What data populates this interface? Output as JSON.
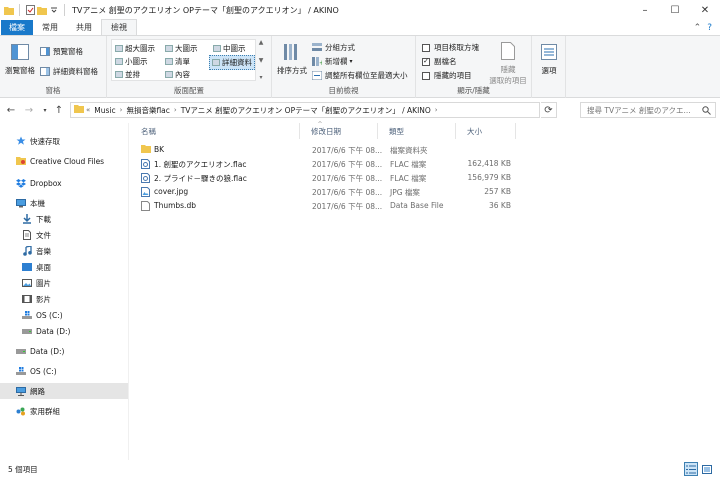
{
  "window": {
    "title": "TVアニメ 創聖のアクエリオン OPテーマ「創聖のアクエリオン」 / AKINO",
    "minimize": "–",
    "maximize": "☐",
    "close": "✕"
  },
  "tabs": {
    "file": "檔案",
    "home": "常用",
    "share": "共用",
    "view": "檢視"
  },
  "ribbon": {
    "panes": {
      "label": "窗格",
      "nav_pane": "瀏覽窗格",
      "preview_pane": "預覽窗格",
      "details_pane": "詳細資料窗格"
    },
    "layout": {
      "label": "版面配置",
      "items": [
        "超大圖示",
        "大圖示",
        "中圖示",
        "小圖示",
        "清單",
        "詳細資料",
        "並排",
        "內容"
      ]
    },
    "current_view": {
      "label": "目前檢視",
      "sort_by": "排序方式",
      "group_by": "分組方式",
      "add_columns": "新增欄",
      "size_all_columns": "調整所有欄位至最適大小"
    },
    "show_hide": {
      "label": "顯示/隱藏",
      "item_checkboxes": "項目核取方塊",
      "item_checkboxes_checked": false,
      "file_name_extensions": "副檔名",
      "file_name_extensions_checked": true,
      "hidden_items": "隱藏的項目",
      "hidden_items_checked": false,
      "hide_selected": "隱藏",
      "hide_selected_line2": "選取的項目"
    },
    "options": "選項"
  },
  "address": {
    "segments": [
      "Music",
      "無損音樂flac",
      "TVアニメ 創聖のアクエリオン OPテーマ「創聖のアクエリオン」 / AKINO"
    ],
    "search_placeholder": "搜尋 TVアニメ 創聖のアクエ..."
  },
  "nav": {
    "quick_access": "快速存取",
    "creative_cloud": "Creative Cloud Files",
    "dropbox": "Dropbox",
    "this_pc": "本機",
    "downloads": "下載",
    "documents": "文件",
    "music": "音樂",
    "desktop": "桌面",
    "pictures": "圖片",
    "videos": "影片",
    "os_c": "OS (C:)",
    "data_d": "Data (D:)",
    "data_d2": "Data (D:)",
    "os_c2": "OS (C:)",
    "network": "網路",
    "homegroup": "家用群組"
  },
  "columns": {
    "name": "名稱",
    "date": "修改日期",
    "type": "類型",
    "size": "大小"
  },
  "files": [
    {
      "name": "BK",
      "date": "2017/6/6 下午 08...",
      "type": "檔案資料夾",
      "size": "",
      "icon": "folder-icon"
    },
    {
      "name": "1. 創聖のアクエリオン.flac",
      "date": "2017/6/6 下午 08...",
      "type": "FLAC 檔案",
      "size": "162,418 KB",
      "icon": "audio-file-icon"
    },
    {
      "name": "2. プライド－驟きの狼.flac",
      "date": "2017/6/6 下午 08...",
      "type": "FLAC 檔案",
      "size": "156,979 KB",
      "icon": "audio-file-icon"
    },
    {
      "name": "cover.jpg",
      "date": "2017/6/6 下午 08...",
      "type": "JPG 檔案",
      "size": "257 KB",
      "icon": "image-file-icon"
    },
    {
      "name": "Thumbs.db",
      "date": "2017/6/6 下午 08...",
      "type": "Data Base File",
      "size": "36 KB",
      "icon": "generic-file-icon"
    }
  ],
  "status": {
    "count": "5 個項目"
  }
}
